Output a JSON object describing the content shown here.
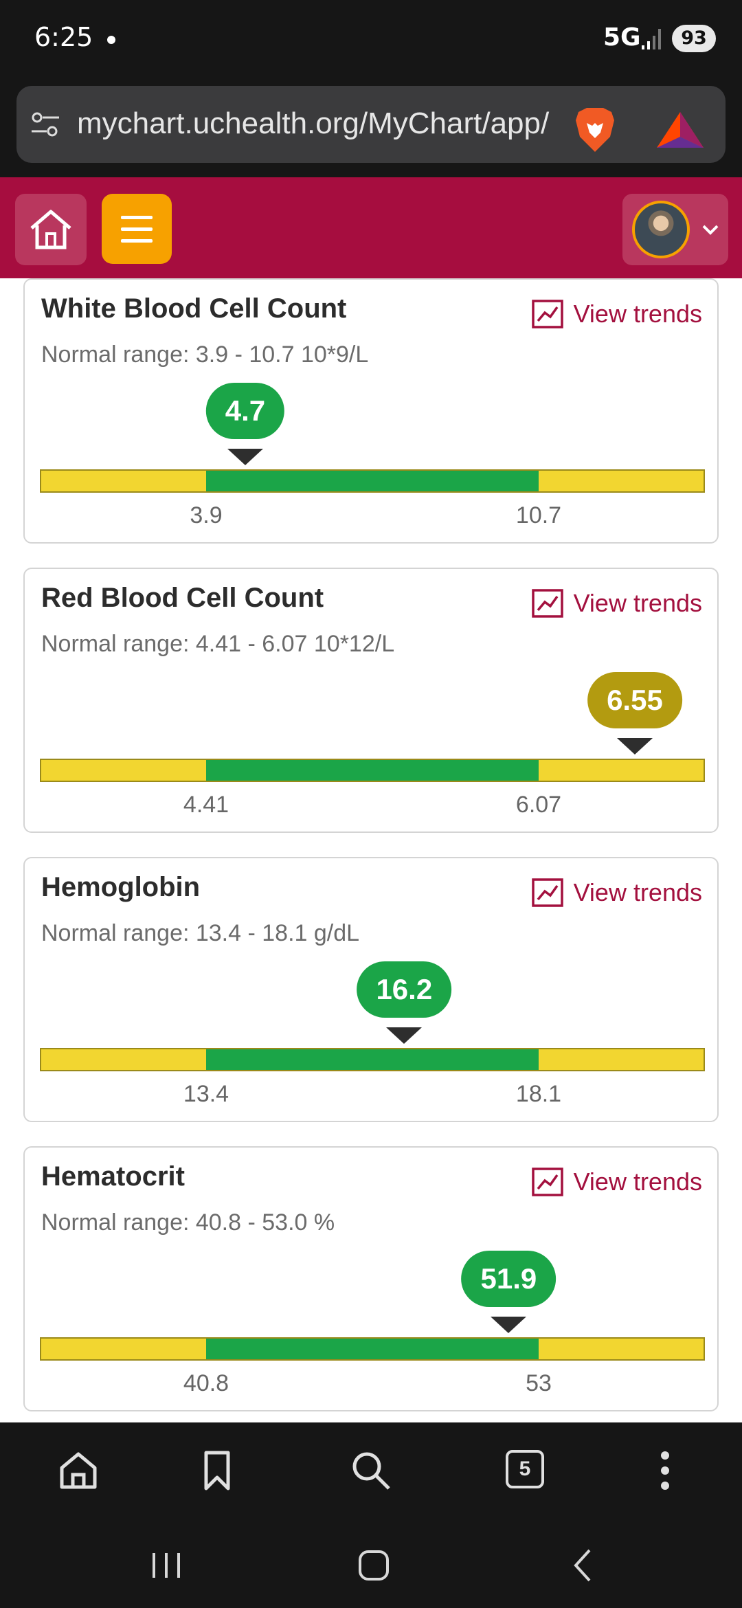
{
  "status_bar": {
    "time": "6:25",
    "network": "5G",
    "battery": "93"
  },
  "browser": {
    "url": "mychart.uchealth.org/MyChart/app/",
    "tab_count": "5"
  },
  "colors": {
    "header": "#a60d3f",
    "menu_button": "#f7a100",
    "in_range": "#1ba548",
    "out_of_range": "#f2d630",
    "high_badge": "#b39b10",
    "link": "#a3103e"
  },
  "results": [
    {
      "title": "White Blood Cell Count",
      "range_text": "Normal range: 3.9 - 10.7 10*9/L",
      "low_label": "3.9",
      "high_label": "10.7",
      "low": 3.9,
      "high": 10.7,
      "value": 4.7,
      "value_text": "4.7",
      "status": "normal",
      "trend_label": "View trends"
    },
    {
      "title": "Red Blood Cell Count",
      "range_text": "Normal range: 4.41 - 6.07 10*12/L",
      "low_label": "4.41",
      "high_label": "6.07",
      "low": 4.41,
      "high": 6.07,
      "value": 6.55,
      "value_text": "6.55",
      "status": "high",
      "trend_label": "View trends"
    },
    {
      "title": "Hemoglobin",
      "range_text": "Normal range: 13.4 - 18.1 g/dL",
      "low_label": "13.4",
      "high_label": "18.1",
      "low": 13.4,
      "high": 18.1,
      "value": 16.2,
      "value_text": "16.2",
      "status": "normal",
      "trend_label": "View trends"
    },
    {
      "title": "Hematocrit",
      "range_text": "Normal range: 40.8 - 53.0 %",
      "low_label": "40.8",
      "high_label": "53",
      "low": 40.8,
      "high": 53.0,
      "value": 51.9,
      "value_text": "51.9",
      "status": "normal",
      "trend_label": "View trends"
    }
  ]
}
